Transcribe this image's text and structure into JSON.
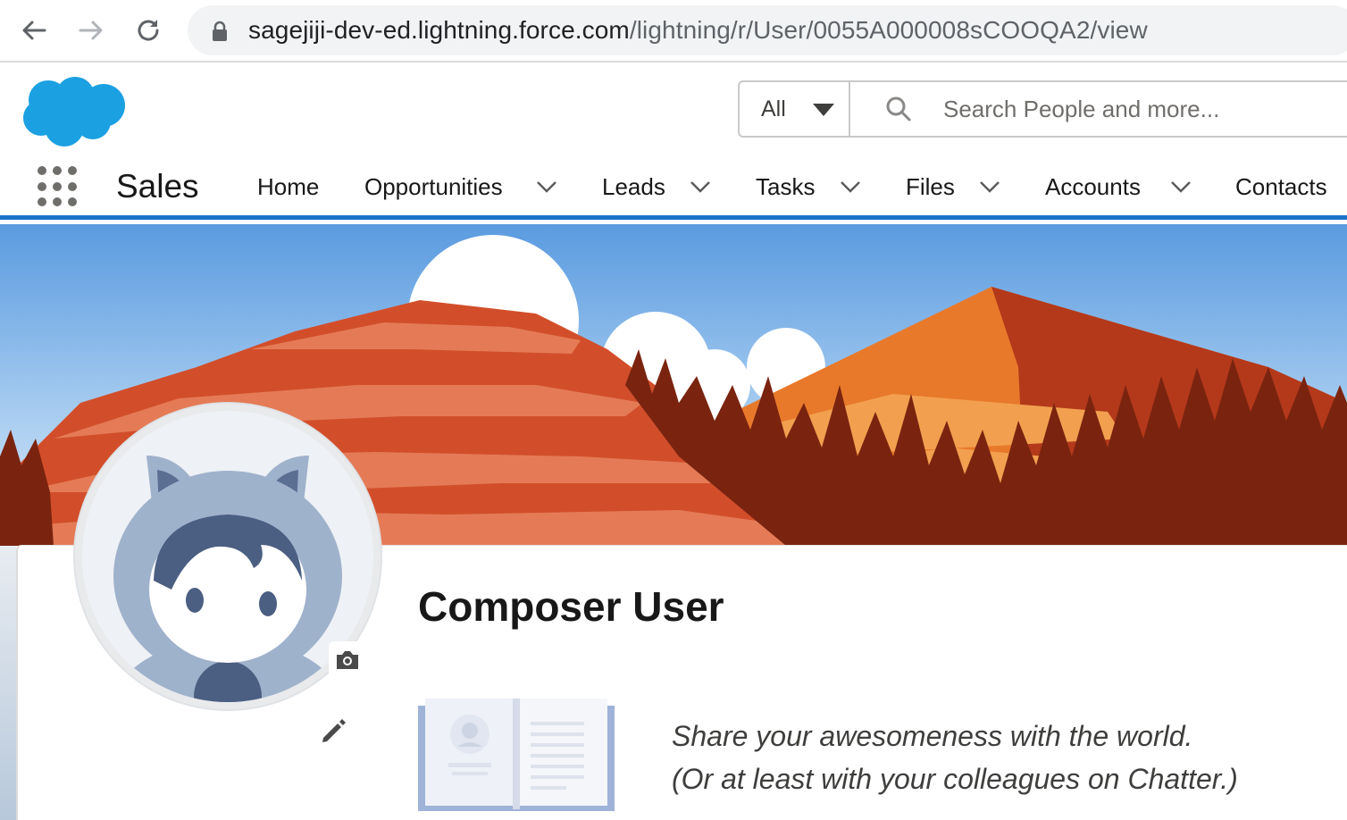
{
  "browser": {
    "url_host": "sagejiji-dev-ed.lightning.force.com",
    "url_path": "/lightning/r/User/0055A000008sCOOQA2/view",
    "icons": [
      "back-arrow-icon",
      "forward-arrow-icon",
      "reload-icon",
      "lock-icon"
    ]
  },
  "header": {
    "logo": "salesforce-cloud-logo",
    "search_scope": "All",
    "search_placeholder": "Search People and more..."
  },
  "app_nav": {
    "app_name": "Sales",
    "items": [
      {
        "label": "Home",
        "has_menu": false
      },
      {
        "label": "Opportunities",
        "has_menu": true
      },
      {
        "label": "Leads",
        "has_menu": true
      },
      {
        "label": "Tasks",
        "has_menu": true
      },
      {
        "label": "Files",
        "has_menu": true
      },
      {
        "label": "Accounts",
        "has_menu": true
      },
      {
        "label": "Contacts",
        "has_menu": false
      }
    ]
  },
  "profile": {
    "name": "Composer User",
    "promo_line_1": "Share your awesomeness with the world.",
    "promo_line_2": "(Or at least with your colleagues on Chatter.)"
  },
  "colors": {
    "brand_blue": "#1b72c8",
    "salesforce_cloud": "#1ba0e2",
    "sky_top": "#5a9be0",
    "mountain_red": "#d24e2a",
    "mountain_orange": "#e8792a",
    "forest": "#7a2410"
  }
}
